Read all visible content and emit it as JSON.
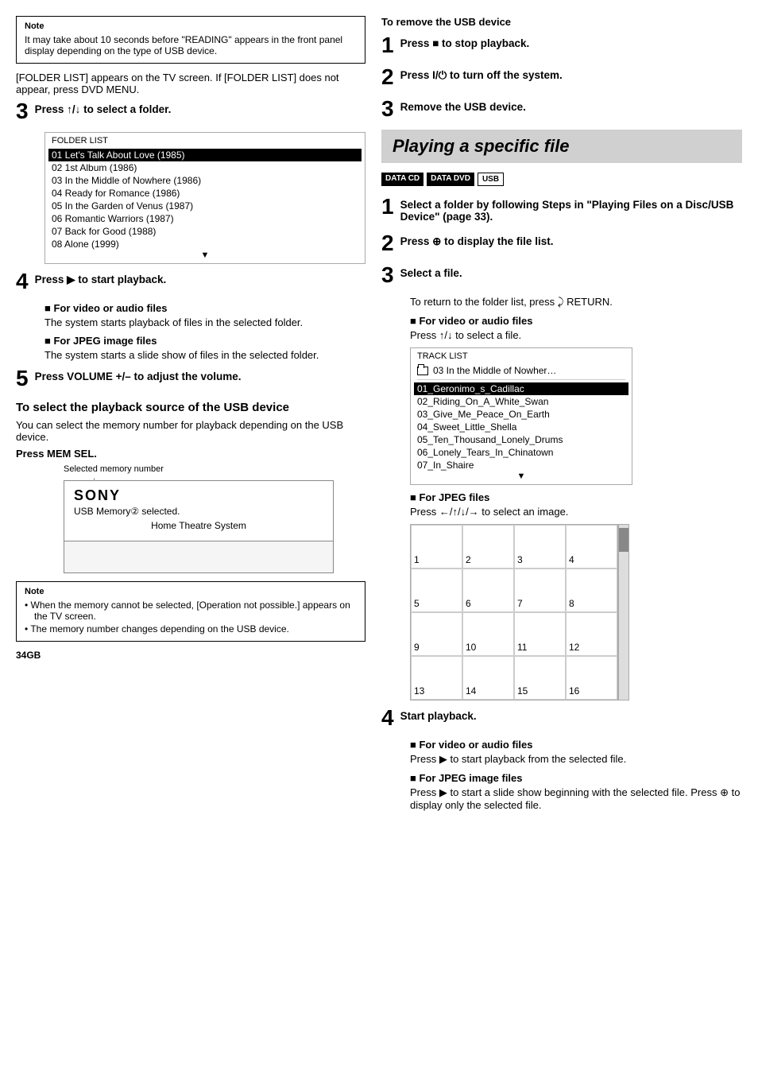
{
  "left": {
    "note1": {
      "label": "Note",
      "items": [
        "It may take about 10 seconds before \"READING\" appears in the front panel display depending on the type of USB device."
      ]
    },
    "folder_list_intro": "[FOLDER LIST] appears on the TV screen. If [FOLDER LIST] does not appear, press DVD MENU.",
    "step3": {
      "num": "3",
      "text": "Press ↑/↓ to select a folder.",
      "folder_list": {
        "title": "FOLDER LIST",
        "items": [
          "01  Let's Talk About Love (1985)",
          "02  1st Album (1986)",
          "03  In the Middle of Nowhere (1986)",
          "04  Ready for Romance (1986)",
          "05  In the Garden of Venus (1987)",
          "06  Romantic Warriors (1987)",
          "07  Back for Good (1988)",
          "08  Alone (1999)"
        ],
        "highlighted": 0,
        "more_indicator": "▼"
      }
    },
    "step4": {
      "num": "4",
      "text": "Press ▶ to start playback.",
      "sub1": {
        "title": "■ For video or audio files",
        "text": "The system starts playback of files in the selected folder."
      },
      "sub2": {
        "title": "■ For JPEG image files",
        "text": "The system starts a slide show of files in the selected folder."
      }
    },
    "step5": {
      "num": "5",
      "text": "Press VOLUME +/– to adjust the volume."
    },
    "usb_section": {
      "heading": "To select the playback source of the USB device",
      "intro": "You can select the memory number for playback depending on the USB device.",
      "press_mem": "Press MEM SEL.",
      "memory_label": "Selected memory number",
      "sony": "SONY",
      "memory_desc": "USB Memory② selected.",
      "home_theatre": "Home Theatre System"
    },
    "note2": {
      "label": "Note",
      "items": [
        "When the memory cannot be selected, [Operation not possible.] appears on the TV screen.",
        "The memory number changes depending on the USB device."
      ]
    },
    "page_num": "34GB"
  },
  "right": {
    "remove_usb": {
      "heading": "To remove the USB device",
      "step1": "Press ■ to stop playback.",
      "step2": "Press I/⏻ to turn off the system.",
      "step3": "Remove the USB device."
    },
    "section_title": "Playing a specific file",
    "badges": [
      "DATA CD",
      "DATA DVD",
      "USB"
    ],
    "step1": {
      "num": "1",
      "text": "Select a folder by following Steps in \"Playing Files on a Disc/USB Device\" (page 33)."
    },
    "step2": {
      "num": "2",
      "text": "Press ⊕ to display the file list."
    },
    "step3": {
      "num": "3",
      "text": "Select a file.",
      "sub_return": "To return to the folder list, press ⤸ RETURN.",
      "sub1": {
        "title": "■ For video or audio files",
        "text": "Press ↑/↓ to select a file."
      },
      "track_list": {
        "title": "TRACK LIST",
        "folder_item": "03  In the Middle of Nowher…",
        "items": [
          "01_Geronimo_s_Cadillac",
          "02_Riding_On_A_White_Swan",
          "03_Give_Me_Peace_On_Earth",
          "04_Sweet_Little_Shella",
          "05_Ten_Thousand_Lonely_Drums",
          "06_Lonely_Tears_In_Chinatown",
          "07_In_Shaire"
        ],
        "highlighted": 0,
        "more_indicator": "▼"
      },
      "sub2": {
        "title": "■ For JPEG files",
        "text": "Press ←/↑/↓/→ to select an image."
      },
      "grid": {
        "cells": [
          {
            "num": "1"
          },
          {
            "num": "2"
          },
          {
            "num": "3"
          },
          {
            "num": "4"
          },
          {
            "num": "5"
          },
          {
            "num": "6"
          },
          {
            "num": "7"
          },
          {
            "num": "8"
          },
          {
            "num": "9"
          },
          {
            "num": "10"
          },
          {
            "num": "11"
          },
          {
            "num": "12"
          },
          {
            "num": "13"
          },
          {
            "num": "14"
          },
          {
            "num": "15"
          },
          {
            "num": "16"
          }
        ]
      }
    },
    "step4": {
      "num": "4",
      "text": "Start playback.",
      "sub1": {
        "title": "■ For video or audio files",
        "text": "Press ▶ to start playback from the selected file."
      },
      "sub2": {
        "title": "■ For JPEG image files",
        "text": "Press ▶ to start a slide show beginning with the selected file. Press ⊕ to display only the selected file."
      }
    }
  }
}
